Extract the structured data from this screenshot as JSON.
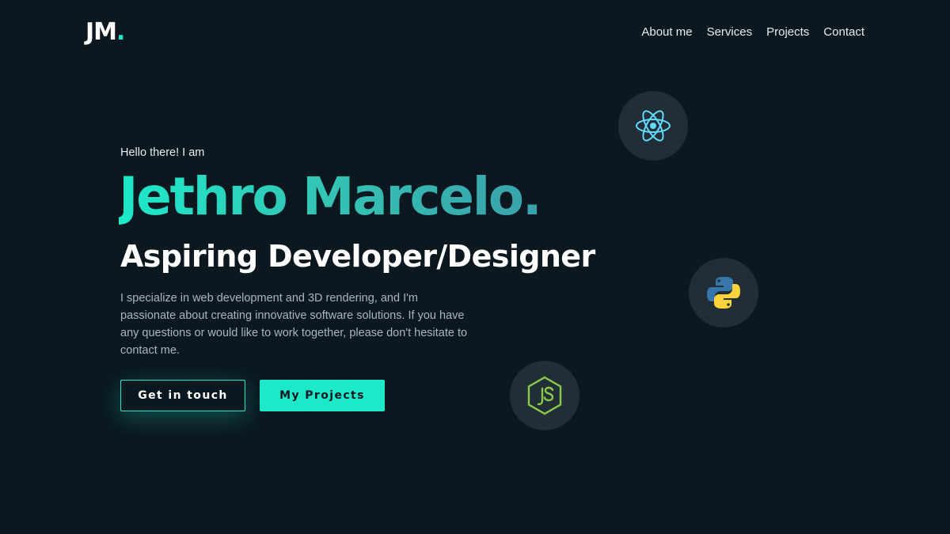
{
  "header": {
    "logo_text": "JM",
    "logo_dot": ".",
    "nav": [
      {
        "label": "About me"
      },
      {
        "label": "Services"
      },
      {
        "label": "Projects"
      },
      {
        "label": "Contact"
      }
    ]
  },
  "hero": {
    "greeting": "Hello there! I am",
    "name": "Jethro Marcelo.",
    "role": "Aspiring Developer/Designer",
    "bio": "I specialize in web development and 3D rendering, and I'm passionate about creating innovative software solutions. If you have any questions or would like to work together, please don't hesitate to contact me.",
    "primary_button": "Get in touch",
    "secondary_button": "My Projects"
  },
  "tech_icons": [
    {
      "icon": "react-icon",
      "color": "#61dafb"
    },
    {
      "icon": "python-icon",
      "colors": [
        "#3776ab",
        "#ffd43b"
      ]
    },
    {
      "icon": "nodejs-icon",
      "color": "#8cc84b"
    }
  ],
  "colors": {
    "background": "#0b1820",
    "accent": "#1de9c9",
    "bubble": "#222e35",
    "text_muted": "#aab6bd"
  }
}
